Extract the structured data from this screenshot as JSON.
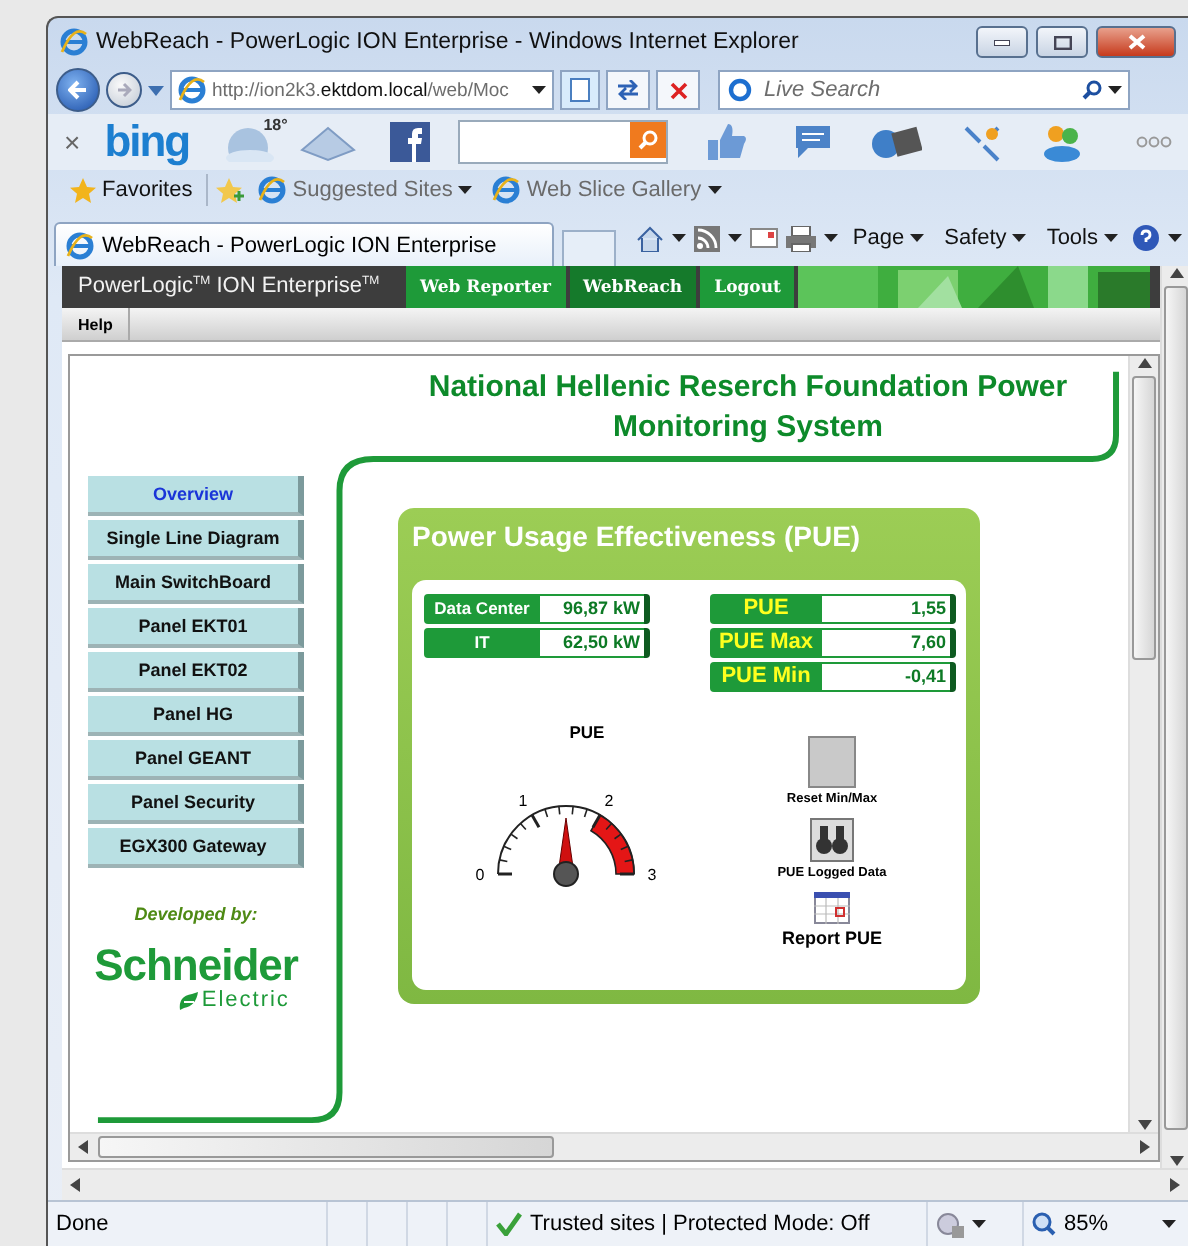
{
  "window": {
    "title": "WebReach - PowerLogic ION Enterprise - Windows Internet Explorer"
  },
  "address_bar": {
    "url_start": "http://ion2k3.",
    "url_domain": "ektdom.local",
    "url_end": "/web/Moc"
  },
  "search": {
    "placeholder": "Live Search"
  },
  "bing_bar": {
    "close": "×",
    "logo": "bing",
    "temperature": "18°"
  },
  "favorites_bar": {
    "favorites": "Favorites",
    "links": [
      {
        "label": "Suggested Sites"
      },
      {
        "label": "Web Slice Gallery"
      }
    ]
  },
  "tabs": [
    {
      "label": "WebReach - PowerLogic ION Enterprise",
      "selected": true
    }
  ],
  "command_bar": [
    {
      "label": "Page"
    },
    {
      "label": "Safety"
    },
    {
      "label": "Tools"
    }
  ],
  "app_header": {
    "brand": "PowerLogic$^{TM}$ ION Enterprise$^{TM}$",
    "nav": [
      {
        "label": "Web Reporter",
        "selected": false
      },
      {
        "label": "WebReach",
        "selected": true
      },
      {
        "label": "Logout",
        "selected": false
      }
    ]
  },
  "menu": [
    {
      "label": "Help"
    }
  ],
  "page": {
    "title": "National Hellenic Reserch Foundation Power Monitoring System",
    "sidebar": [
      {
        "label": "Overview",
        "selected": true
      },
      {
        "label": "Single Line Diagram",
        "selected": false
      },
      {
        "label": "Main SwitchBoard",
        "selected": false
      },
      {
        "label": "Panel EKT01",
        "selected": false
      },
      {
        "label": "Panel EKT02",
        "selected": false
      },
      {
        "label": "Panel HG",
        "selected": false
      },
      {
        "label": "Panel GEANT",
        "selected": false
      },
      {
        "label": "Panel Security",
        "selected": false
      },
      {
        "label": "EGX300 Gateway",
        "selected": false
      }
    ],
    "developed_by": "Developed by:",
    "logo": {
      "name": "Schneider",
      "sub": "Electric"
    }
  },
  "panel": {
    "title": "Power Usage Effectiveness (PUE)",
    "power_readings": [
      {
        "label": "Data Center",
        "value": "96,87 kW"
      },
      {
        "label": "IT",
        "value": "62,50 kW"
      }
    ],
    "pue_readings": [
      {
        "label": "PUE",
        "value": "1,55"
      },
      {
        "label": "PUE Max",
        "value": "7,60"
      },
      {
        "label": "PUE Min",
        "value": "-0,41"
      }
    ],
    "gauge": {
      "title": "PUE",
      "ticks": [
        "0",
        "1",
        "2",
        "3"
      ]
    },
    "actions": [
      {
        "label": "Reset Min/Max",
        "kind": "blank"
      },
      {
        "label": "PUE Logged Data",
        "kind": "binoculars"
      },
      {
        "label": "Report PUE",
        "kind": "calendar"
      }
    ]
  },
  "status_bar": {
    "status": "Done",
    "zone": "Trusted sites | Protected Mode: Off",
    "zoom": "85%"
  }
}
